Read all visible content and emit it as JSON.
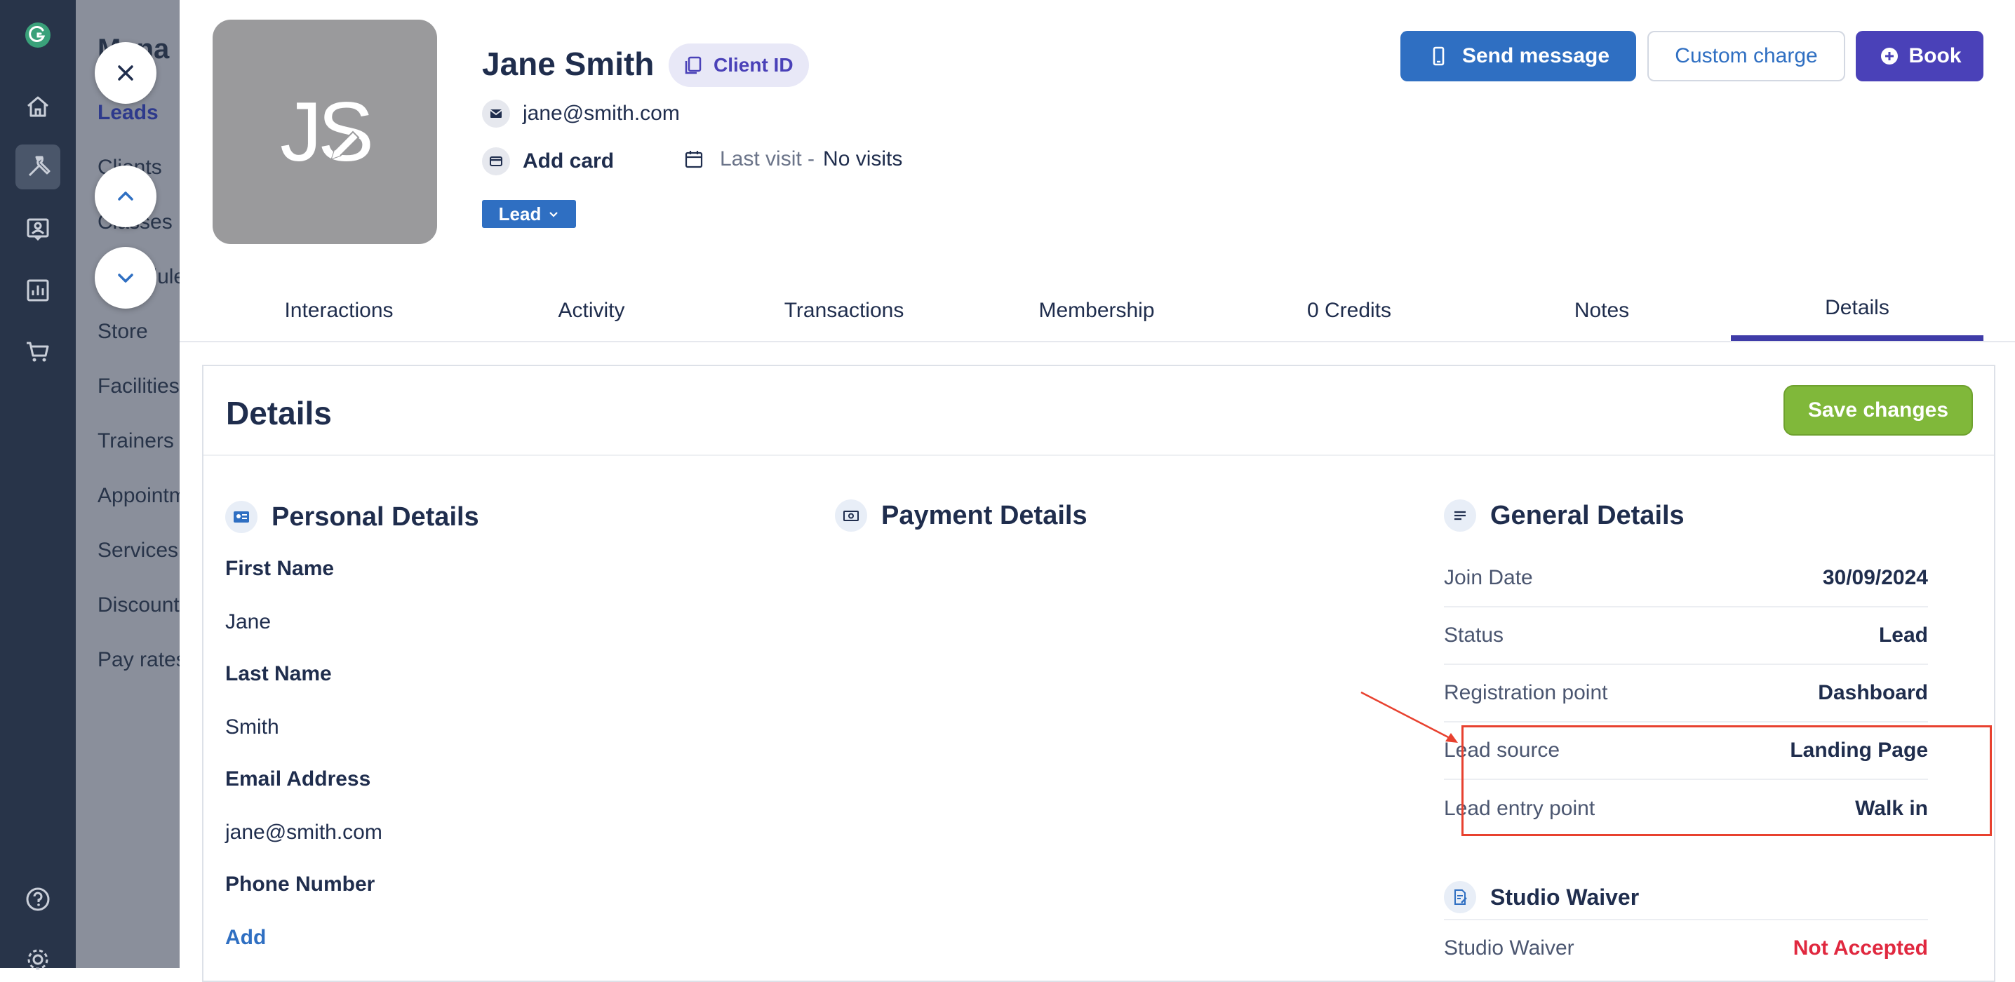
{
  "subnav": {
    "title": "Mana",
    "items": [
      "Leads",
      "Clients",
      "Classes",
      "Schedules",
      "Store",
      "Facilities",
      "Trainers",
      "Appointments",
      "Services",
      "Discounts",
      "Pay rates"
    ]
  },
  "client": {
    "initials": "JS",
    "name": "Jane Smith",
    "client_id_label": "Client ID",
    "email": "jane@smith.com",
    "add_card_label": "Add card",
    "last_visit_label": "Last visit -",
    "last_visit_value": "No visits",
    "status_badge": "Lead"
  },
  "actions": {
    "send_message": "Send message",
    "custom_charge": "Custom charge",
    "book": "Book"
  },
  "tabs": [
    "Interactions",
    "Activity",
    "Transactions",
    "Membership",
    "0 Credits",
    "Notes",
    "Details"
  ],
  "active_tab": "Details",
  "details": {
    "title": "Details",
    "save_label": "Save changes",
    "personal": {
      "heading": "Personal Details",
      "first_name_label": "First Name",
      "first_name": "Jane",
      "last_name_label": "Last Name",
      "last_name": "Smith",
      "email_label": "Email Address",
      "email": "jane@smith.com",
      "phone_label": "Phone Number",
      "phone_action": "Add"
    },
    "payment": {
      "heading": "Payment Details"
    },
    "general": {
      "heading": "General Details",
      "rows": [
        {
          "label": "Join Date",
          "value": "30/09/2024"
        },
        {
          "label": "Status",
          "value": "Lead"
        },
        {
          "label": "Registration point",
          "value": "Dashboard"
        },
        {
          "label": "Lead source",
          "value": "Landing Page"
        },
        {
          "label": "Lead entry point",
          "value": "Walk in"
        }
      ]
    },
    "waiver": {
      "heading": "Studio Waiver",
      "label": "Studio Waiver",
      "value": "Not Accepted"
    }
  },
  "colors": {
    "primary": "#2f6fc2",
    "purple": "#4a41b8",
    "save_green": "#80b83a",
    "alert_red": "#e0283f",
    "annotation_red": "#e8412f"
  }
}
